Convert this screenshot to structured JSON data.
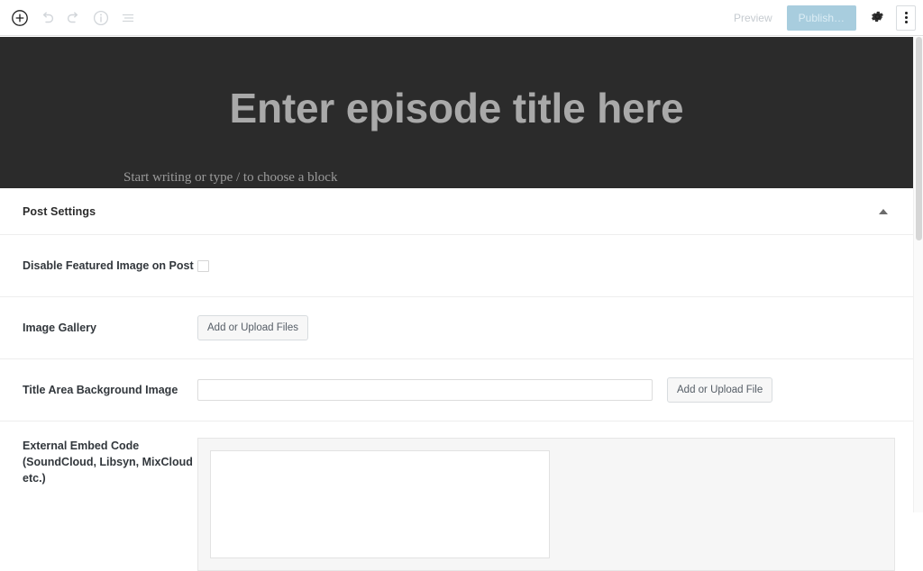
{
  "toolbar": {
    "left_tools": [
      {
        "name": "add-block-icon",
        "label": "Add block"
      },
      {
        "name": "undo-icon",
        "label": "Undo"
      },
      {
        "name": "redo-icon",
        "label": "Redo"
      },
      {
        "name": "details-icon",
        "label": "Details"
      },
      {
        "name": "list-view-icon",
        "label": "List view"
      }
    ],
    "preview_label": "Preview",
    "publish_label": "Publish…",
    "settings_icon": "gear-icon",
    "more_icon": "kebab-menu-icon"
  },
  "hero": {
    "title_placeholder": "Enter episode title here",
    "body_placeholder": "Start writing or type / to choose a block",
    "background_color": "#2b2b2b",
    "title_color": "#a9a9a9"
  },
  "panel": {
    "title": "Post Settings",
    "toggle_icon": "caret-up-icon",
    "fields": [
      {
        "key": "disable_featured_image",
        "label": "Disable Featured Image on Post",
        "type": "checkbox",
        "checked": false
      },
      {
        "key": "image_gallery",
        "label": "Image Gallery",
        "type": "button",
        "button_label": "Add or Upload Files"
      },
      {
        "key": "title_area_background_image",
        "label": "Title Area Background Image",
        "type": "text-with-button",
        "value": "",
        "placeholder": "",
        "button_label": "Add or Upload File"
      },
      {
        "key": "external_embed_code",
        "label": "External Embed Code (SoundCloud, Libsyn, MixCloud etc.)",
        "label_line1": "External Embed Code",
        "label_line2": "(SoundCloud, Libsyn, MixCloud",
        "label_line3": "etc.)",
        "type": "textarea",
        "value": "",
        "placeholder": ""
      }
    ]
  },
  "colors": {
    "publish_button": "#a8cdde",
    "hero_background": "#2b2b2b",
    "panel_border": "#eeeeee",
    "button_face": "#f7f7f7"
  }
}
